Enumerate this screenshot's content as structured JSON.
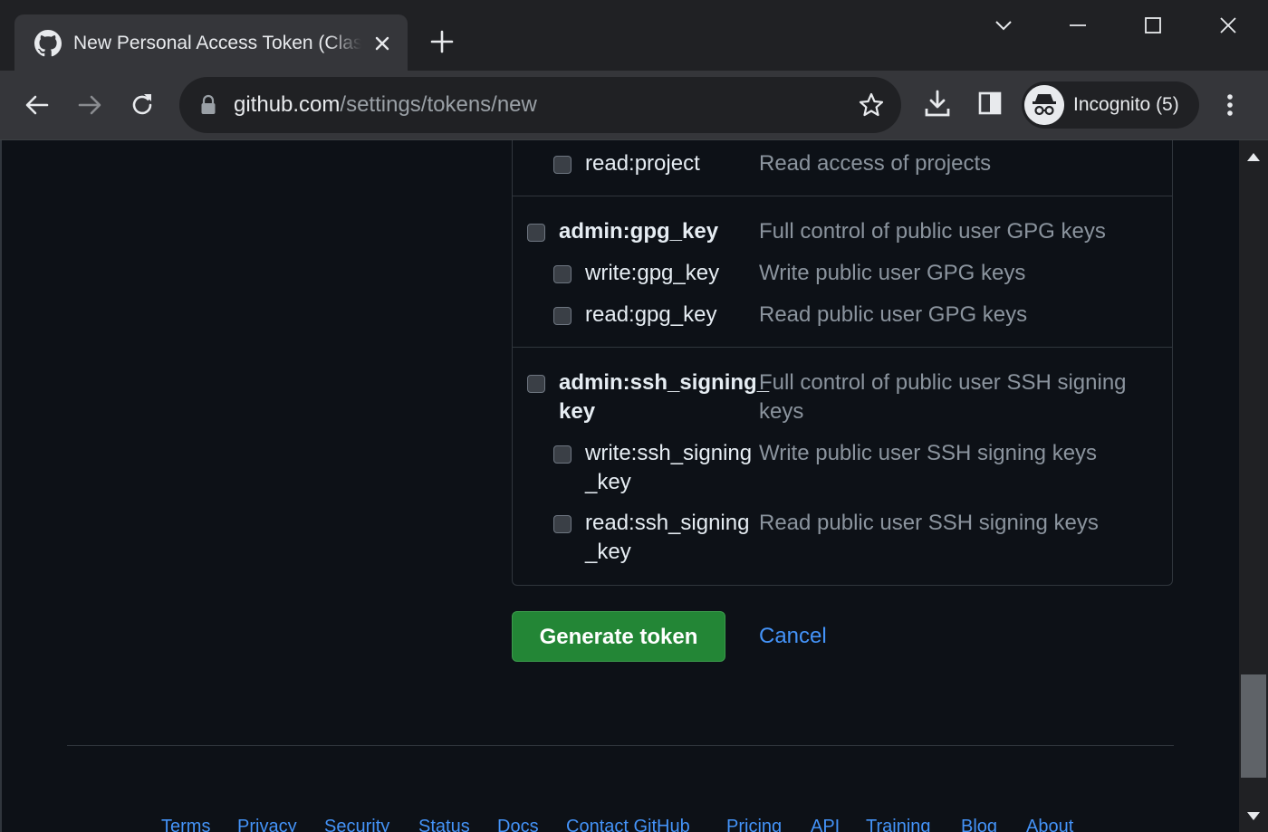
{
  "browser": {
    "tab_title": "New Personal Access Token (Classic)",
    "url_host": "github.com",
    "url_path": "/settings/tokens/new",
    "profile_label": "Incognito (5)"
  },
  "scopes": {
    "project_read": {
      "name": "read:project",
      "desc": "Read access of projects"
    },
    "gpg": {
      "admin": {
        "name": "admin:gpg_key",
        "desc": "Full control of public user GPG keys"
      },
      "write": {
        "name": "write:gpg_key",
        "desc": "Write public user GPG keys"
      },
      "read": {
        "name": "read:gpg_key",
        "desc": "Read public user GPG keys"
      }
    },
    "ssh_signing": {
      "admin": {
        "name_l1": "admin:ssh_signing_",
        "name_l2": "key",
        "desc_l1": "Full control of public user SSH signing",
        "desc_l2": "keys"
      },
      "write": {
        "name_l1": "write:ssh_signing",
        "name_l2": "_key",
        "desc": "Write public user SSH signing keys"
      },
      "read": {
        "name_l1": "read:ssh_signing",
        "name_l2": "_key",
        "desc": "Read public user SSH signing keys"
      }
    }
  },
  "actions": {
    "generate_label": "Generate token",
    "cancel_label": "Cancel"
  },
  "footer": {
    "links": [
      "Terms",
      "Privacy",
      "Security",
      "Status",
      "Docs",
      "Contact GitHub",
      "Pricing",
      "API",
      "Training",
      "Blog",
      "About"
    ]
  },
  "colors": {
    "page_bg": "#0d1117",
    "primary_button": "#238636",
    "link": "#4493f8",
    "muted_text": "#8b949e"
  }
}
